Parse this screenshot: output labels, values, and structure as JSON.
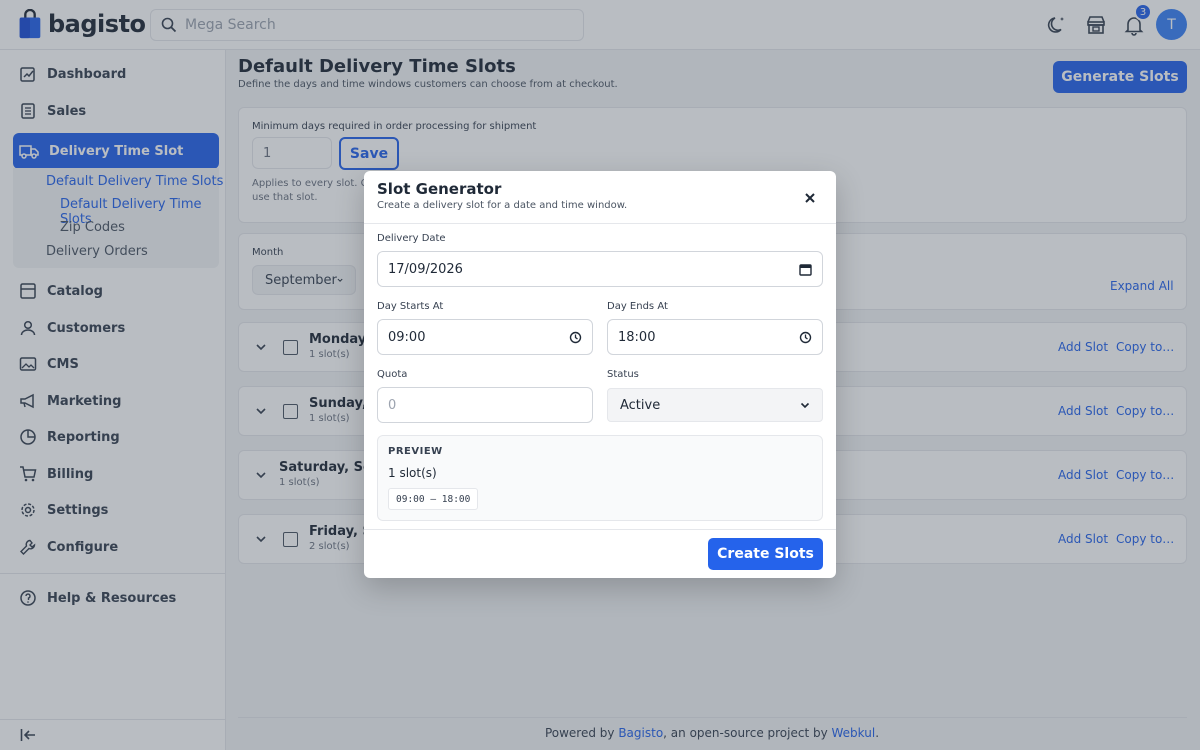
{
  "header": {
    "logo_text": "bagisto",
    "search_placeholder": "Mega Search",
    "notification_count": "3",
    "avatar_initial": "T"
  },
  "sidebar": {
    "items": [
      {
        "label": "Dashboard",
        "icon": "dashboard-icon"
      },
      {
        "label": "Sales",
        "icon": "sales-icon"
      },
      {
        "label": "Delivery Time Slot",
        "icon": "truck-icon",
        "active": true
      },
      {
        "label": "Catalog",
        "icon": "catalog-icon"
      },
      {
        "label": "Customers",
        "icon": "customers-icon"
      },
      {
        "label": "CMS",
        "icon": "cms-icon"
      },
      {
        "label": "Marketing",
        "icon": "megaphone-icon"
      },
      {
        "label": "Reporting",
        "icon": "pie-chart-icon"
      },
      {
        "label": "Billing",
        "icon": "cart-icon"
      },
      {
        "label": "Settings",
        "icon": "gear-icon"
      },
      {
        "label": "Configure",
        "icon": "wrench-icon"
      }
    ],
    "sub_items": [
      "Default Delivery Time Slots",
      "Default Delivery Time Slots",
      "Zip Codes",
      "Delivery Orders"
    ],
    "help_label": "Help & Resources"
  },
  "page": {
    "title": "Default Delivery Time Slots",
    "subtitle": "Define the days and time windows customers can choose from at checkout.",
    "generate_button": "Generate Slots",
    "min_days_label": "Minimum days required in order processing for shipment",
    "min_days_value": "1",
    "save_button": "Save",
    "hint_line1": "Applies to every slot. C",
    "hint_line2": "use that slot.",
    "month_label": "Month",
    "month_value": "September",
    "expand_all": "Expand All",
    "days": [
      {
        "title": "Monday,",
        "count": "1 slot(s)",
        "checkbox": true
      },
      {
        "title": "Sunday,",
        "count": "1 slot(s)",
        "checkbox": true
      },
      {
        "title": "Saturday, Se",
        "count": "1 slot(s)",
        "checkbox": false
      },
      {
        "title": "Friday, S",
        "count": "2 slot(s)",
        "checkbox": true
      }
    ],
    "add_slot": "Add Slot",
    "copy_to": "Copy to…"
  },
  "footer": {
    "prefix": "Powered by ",
    "link1": "Bagisto",
    "middle": ", an open-source project by ",
    "link2": "Webkul",
    "suffix": "."
  },
  "modal": {
    "title": "Slot Generator",
    "subtitle": "Create a delivery slot for a date and time window.",
    "delivery_date_label": "Delivery Date",
    "delivery_date_value": "17/09/2026",
    "day_starts_label": "Day Starts At",
    "day_starts_value": "09:00",
    "day_ends_label": "Day Ends At",
    "day_ends_value": "18:00",
    "quota_label": "Quota",
    "quota_placeholder": "0",
    "status_label": "Status",
    "status_value": "Active",
    "preview_label": "PREVIEW",
    "preview_count": "1 slot(s)",
    "preview_chip": "09:00 – 18:00",
    "create_button": "Create Slots"
  },
  "colors": {
    "accent": "#2563eb",
    "overlay": "rgba(55,65,81,0.35)"
  }
}
